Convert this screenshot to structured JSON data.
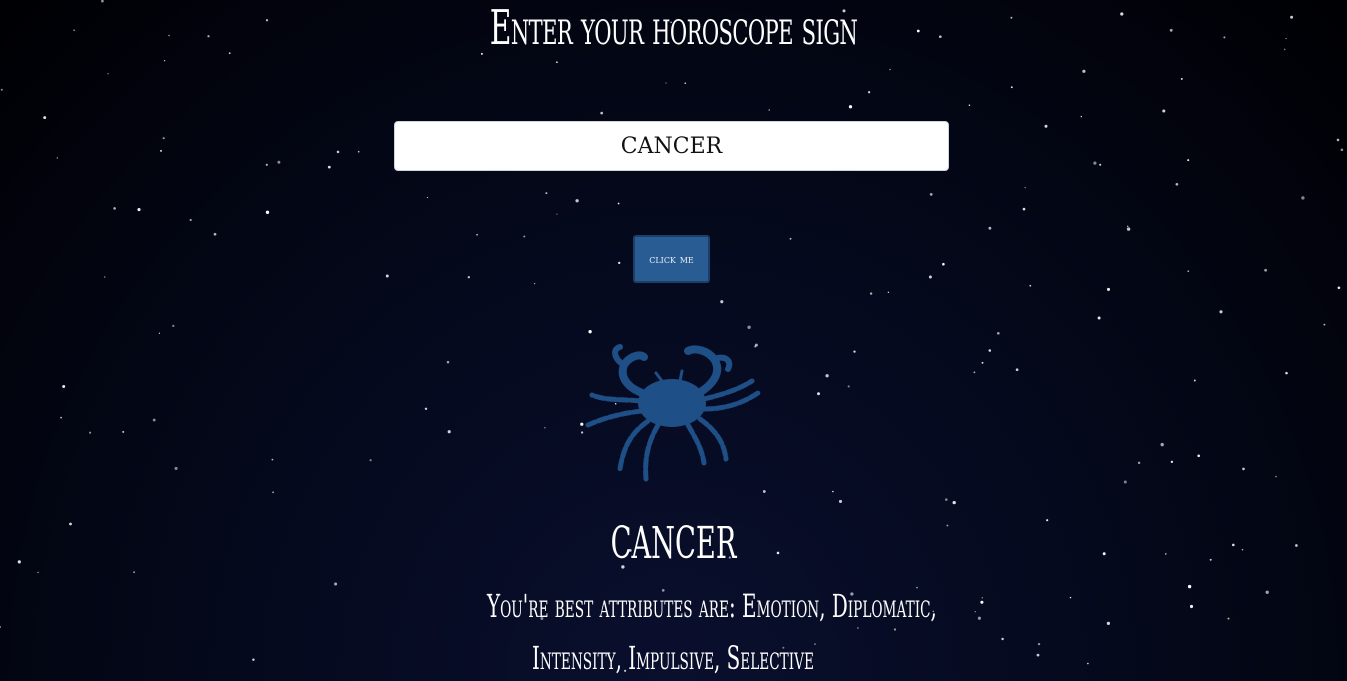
{
  "page": {
    "title": "Enter your horoscope sign"
  },
  "form": {
    "input_value": "CANCER",
    "button_label": "click me"
  },
  "result": {
    "icon": "cancer-crab-icon",
    "sign_name": "CANCER",
    "attributes_line1": "You're best attributes are: Emotion, Diplomatic,",
    "attributes_line2": "Intensity, Impulsive, Selective"
  },
  "colors": {
    "background": "#02040f",
    "button": "#2a5c94",
    "icon": "#1e4f86",
    "text": "#ffffff"
  }
}
